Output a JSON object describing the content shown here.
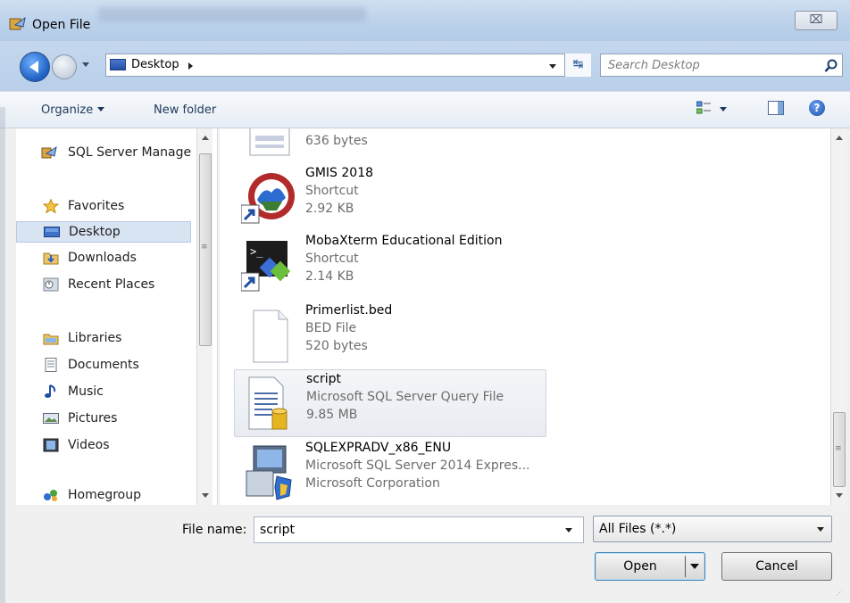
{
  "window": {
    "title": "Open File",
    "close_glyph": "⌧"
  },
  "address": {
    "crumbs": [
      "Desktop"
    ],
    "refresh_glyph": "↹"
  },
  "search": {
    "placeholder": "Search Desktop"
  },
  "toolbar": {
    "organize_label": "Organize",
    "new_folder_label": "New folder",
    "help_glyph": "?"
  },
  "nav": {
    "items": [
      {
        "label": "SQL Server Manage",
        "icon": "sql-server-icon"
      },
      {
        "label": "Favorites",
        "icon": "star-icon"
      },
      {
        "label": "Desktop",
        "icon": "desktop-icon",
        "selected": true
      },
      {
        "label": "Downloads",
        "icon": "downloads-folder-icon"
      },
      {
        "label": "Recent Places",
        "icon": "recent-places-icon"
      },
      {
        "label": "Libraries",
        "icon": "libraries-icon"
      },
      {
        "label": "Documents",
        "icon": "documents-icon"
      },
      {
        "label": "Music",
        "icon": "music-icon"
      },
      {
        "label": "Pictures",
        "icon": "pictures-icon"
      },
      {
        "label": "Videos",
        "icon": "videos-icon"
      },
      {
        "label": "Homegroup",
        "icon": "homegroup-icon"
      }
    ]
  },
  "files": [
    {
      "name": "",
      "type": "",
      "size": "636 bytes",
      "icon": "text-file-icon"
    },
    {
      "name": "GMIS 2018",
      "type": "Shortcut",
      "size": "2.92 KB",
      "icon": "emblem-shortcut-icon"
    },
    {
      "name": "MobaXterm Educational Edition",
      "type": "Shortcut",
      "size": "2.14 KB",
      "icon": "mobaxterm-shortcut-icon"
    },
    {
      "name": "Primerlist.bed",
      "type": "BED File",
      "size": "520 bytes",
      "icon": "blank-file-icon"
    },
    {
      "name": "script",
      "type": "Microsoft SQL Server Query File",
      "size": "9.85 MB",
      "icon": "sql-query-file-icon",
      "selected": true
    },
    {
      "name": "SQLEXPRADV_x86_ENU",
      "type": "Microsoft SQL Server 2014  Expres...",
      "size": "Microsoft Corporation",
      "icon": "installer-icon"
    }
  ],
  "footer": {
    "file_name_label": "File name:",
    "file_name_value": "script",
    "filter_value": "All Files (*.*)",
    "open_label": "Open",
    "cancel_label": "Cancel"
  },
  "colors": {
    "accent": "#3c7fb1",
    "selection": "#d9e4f3",
    "titlebar": "#bfd4ec"
  }
}
